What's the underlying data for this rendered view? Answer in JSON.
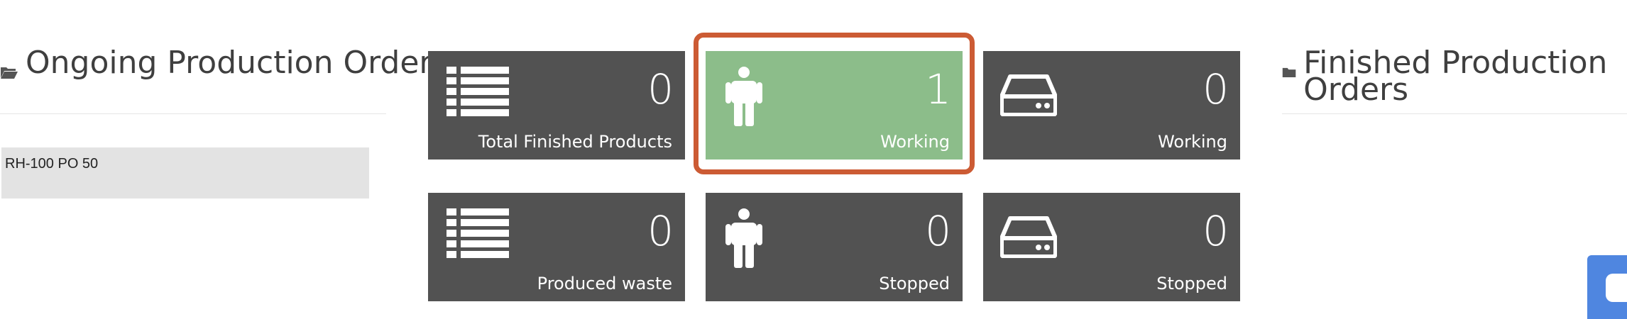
{
  "ongoing_panel": {
    "title": "Ongoing Production Orders",
    "icon": "folder-open-icon"
  },
  "ongoing_orders": [
    {
      "label": "RH-100 PO 50"
    }
  ],
  "finished_panel": {
    "title": "Finished Production Orders",
    "icon": "folder-icon"
  },
  "tiles": [
    {
      "icon": "list-icon",
      "count": "0",
      "label": "Total Finished Products",
      "color": "#525252"
    },
    {
      "icon": "person-icon",
      "count": "1",
      "label": "Working",
      "color": "#8cbd8a",
      "highlighted": true
    },
    {
      "icon": "hard-drive-icon",
      "count": "0",
      "label": "Working",
      "color": "#525252"
    },
    {
      "icon": "list-icon",
      "count": "0",
      "label": "Produced waste",
      "color": "#525252"
    },
    {
      "icon": "person-icon",
      "count": "0",
      "label": "Stopped",
      "color": "#525252"
    },
    {
      "icon": "hard-drive-icon",
      "count": "0",
      "label": "Stopped",
      "color": "#525252"
    }
  ],
  "colors": {
    "tile_default": "#525252",
    "tile_active": "#8cbd8a",
    "highlight_border": "#cc5b34",
    "chat_widget": "#4f86e0"
  },
  "chat_widget": {
    "icon": "chat-icon"
  }
}
